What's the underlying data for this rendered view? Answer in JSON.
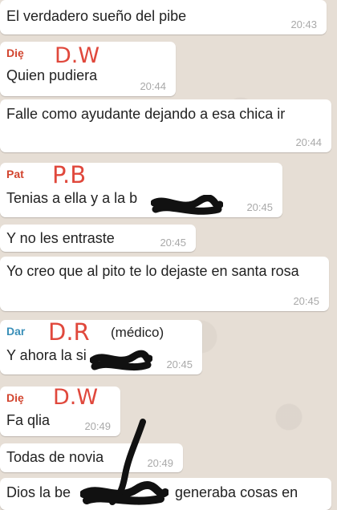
{
  "colors": {
    "chat_background": "#e6ded5",
    "bubble": "#ffffff",
    "annotation_red": "#e0483c",
    "timestamp": "#a9a9a9",
    "censor_ink": "#111111"
  },
  "messages": [
    {
      "text": "El verdadero sueño del pibe",
      "time": "20:43"
    },
    {
      "sender": "Diȩ",
      "sender_color": "#d2452f",
      "annotation": "D.W",
      "text": "Quien pudiera",
      "time": "20:44"
    },
    {
      "text": "Falle como ayudante dejando a esa chica ir",
      "time": "20:44"
    },
    {
      "sender": "Pat",
      "sender_color": "#d2452f",
      "annotation": "P.B",
      "text": "Tenias a ella y a la b",
      "time": "20:45"
    },
    {
      "text": "Y no les entraste",
      "time": "20:45"
    },
    {
      "text": "Yo creo que al pito te lo dejaste en santa rosa",
      "time": "20:45"
    },
    {
      "sender": "Dar",
      "sender_color": "#3a8fb8",
      "annotation": "D.R",
      "annotation_note": "(médico)",
      "text": "Y ahora la si",
      "time": "20:45"
    },
    {
      "sender": "Diȩ",
      "sender_color": "#d2452f",
      "annotation": "D.W",
      "text": "Fa qlia",
      "time": "20:49"
    },
    {
      "text": "Todas de novia",
      "time": "20:49"
    },
    {
      "text": "Dios la be",
      "text_cont": "generaba cosas en"
    }
  ]
}
